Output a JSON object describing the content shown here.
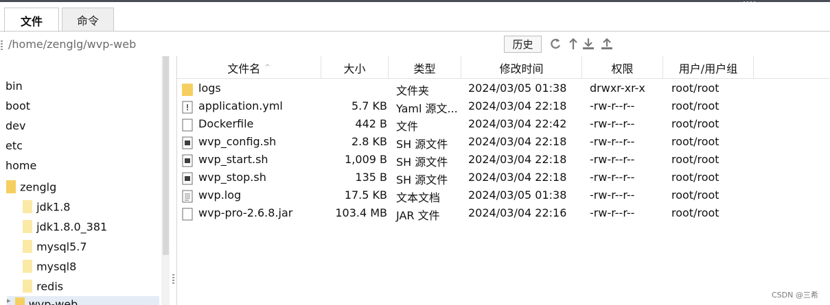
{
  "tabs": [
    {
      "label": "文件",
      "active": true
    },
    {
      "label": "命令",
      "active": false
    }
  ],
  "pathbar": {
    "path": "/home/zenglg/wvp-web",
    "history_label": "历史",
    "icons": [
      "refresh-icon",
      "up-arrow-icon",
      "download-icon",
      "upload-icon"
    ]
  },
  "tree": {
    "items": [
      {
        "label": "bin",
        "folder": false
      },
      {
        "label": "boot",
        "folder": false
      },
      {
        "label": "dev",
        "folder": false
      },
      {
        "label": "etc",
        "folder": false
      },
      {
        "label": "home",
        "folder": false
      },
      {
        "label": "zenglg",
        "folder": true
      },
      {
        "label": "jdk1.8",
        "folder": true
      },
      {
        "label": "jdk1.8.0_381",
        "folder": true
      },
      {
        "label": "mysql5.7",
        "folder": true
      },
      {
        "label": "mysql8",
        "folder": true
      },
      {
        "label": "redis",
        "folder": true
      },
      {
        "label": "wvp-web",
        "folder": true,
        "selected": true
      }
    ]
  },
  "filelist": {
    "columns": [
      {
        "label": "文件名"
      },
      {
        "label": "大小"
      },
      {
        "label": "类型"
      },
      {
        "label": "修改时间"
      },
      {
        "label": "权限"
      },
      {
        "label": "用户/用户组"
      }
    ],
    "rows": [
      {
        "name": "logs",
        "size": "",
        "type": "文件夹",
        "modified": "2024/03/05 01:38",
        "perm": "drwxr-xr-x",
        "owner": "root/root",
        "icon": "folder-icon"
      },
      {
        "name": "application.yml",
        "size": "5.7 KB",
        "type": "Yaml 源文...",
        "modified": "2024/03/04 22:18",
        "perm": "-rw-r--r--",
        "owner": "root/root",
        "icon": "yaml-file-icon"
      },
      {
        "name": "Dockerfile",
        "size": "442 B",
        "type": "文件",
        "modified": "2024/03/04 22:42",
        "perm": "-rw-r--r--",
        "owner": "root/root",
        "icon": "file-icon"
      },
      {
        "name": "wvp_config.sh",
        "size": "2.8 KB",
        "type": "SH 源文件",
        "modified": "2024/03/04 22:18",
        "perm": "-rw-r--r--",
        "owner": "root/root",
        "icon": "script-file-icon"
      },
      {
        "name": "wvp_start.sh",
        "size": "1,009 B",
        "type": "SH 源文件",
        "modified": "2024/03/04 22:18",
        "perm": "-rw-r--r--",
        "owner": "root/root",
        "icon": "script-file-icon"
      },
      {
        "name": "wvp_stop.sh",
        "size": "135 B",
        "type": "SH 源文件",
        "modified": "2024/03/04 22:18",
        "perm": "-rw-r--r--",
        "owner": "root/root",
        "icon": "script-file-icon"
      },
      {
        "name": "wvp.log",
        "size": "17.5 KB",
        "type": "文本文档",
        "modified": "2024/03/05 01:38",
        "perm": "-rw-r--r--",
        "owner": "root/root",
        "icon": "text-file-icon"
      },
      {
        "name": "wvp-pro-2.6.8.jar",
        "size": "103.4 MB",
        "type": "JAR 文件",
        "modified": "2024/03/04 22:16",
        "perm": "-rw-r--r--",
        "owner": "root/root",
        "icon": "file-icon"
      }
    ]
  },
  "watermark": "CSDN @三希",
  "colors": {
    "folder": "#f5cf5f",
    "folder_light": "#fbe9a6",
    "tab_border": "#c9c9c9"
  }
}
